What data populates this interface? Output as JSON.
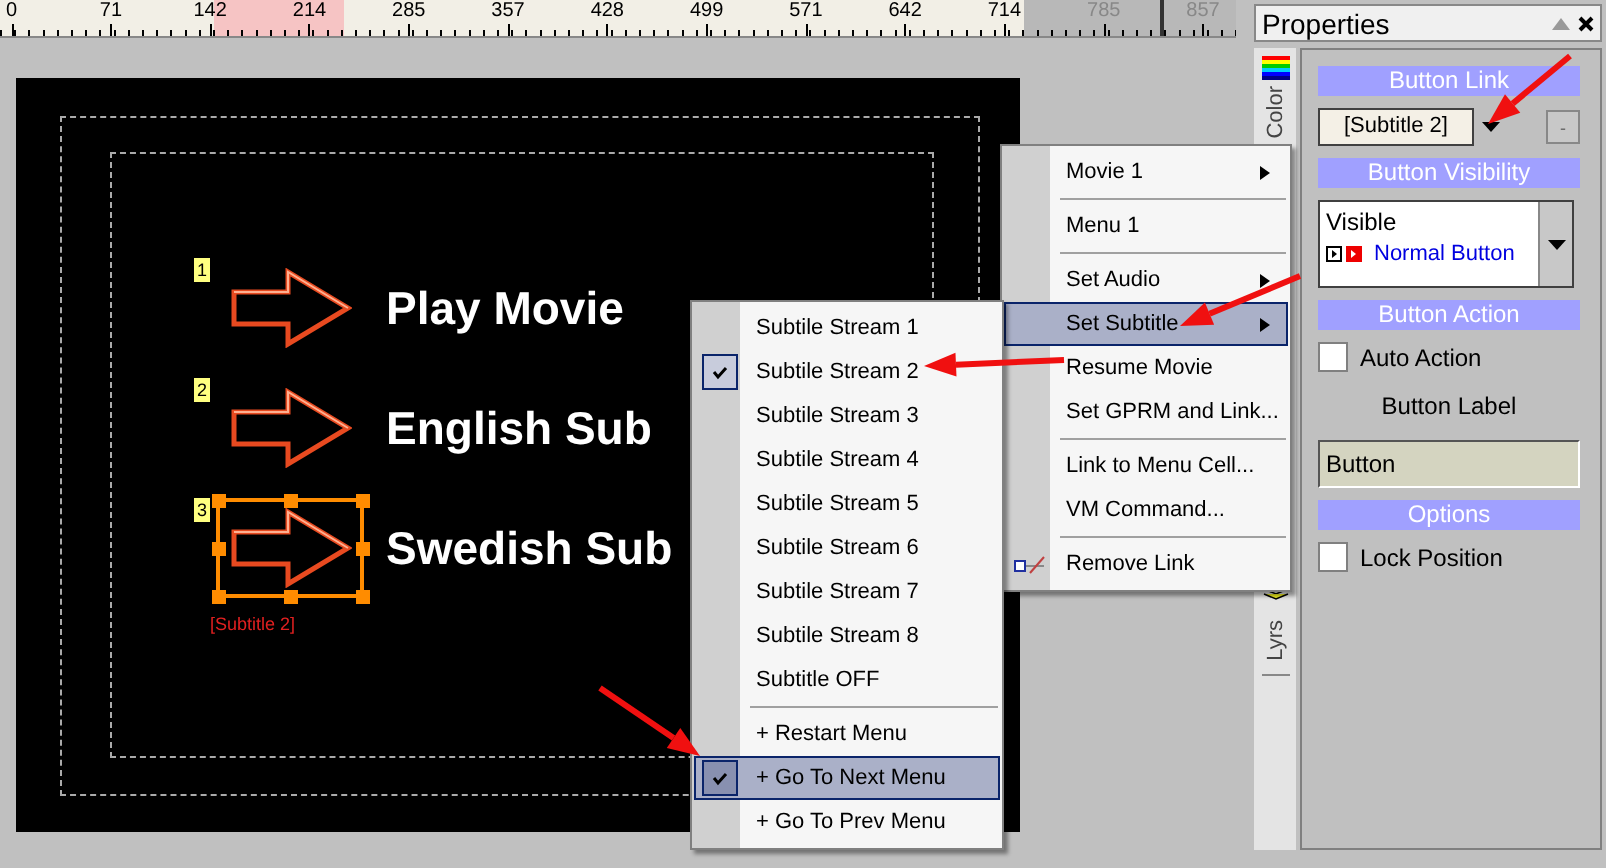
{
  "ruler": {
    "ticks": [
      {
        "label": "0",
        "disabled": false
      },
      {
        "label": "71",
        "disabled": false
      },
      {
        "label": "142",
        "disabled": false
      },
      {
        "label": "214",
        "disabled": false
      },
      {
        "label": "285",
        "disabled": false
      },
      {
        "label": "357",
        "disabled": false
      },
      {
        "label": "428",
        "disabled": false
      },
      {
        "label": "499",
        "disabled": false
      },
      {
        "label": "571",
        "disabled": false
      },
      {
        "label": "642",
        "disabled": false
      },
      {
        "label": "714",
        "disabled": false
      },
      {
        "label": "785",
        "disabled": true
      },
      {
        "label": "857",
        "disabled": true
      }
    ]
  },
  "canvas": {
    "buttons": [
      {
        "number": "1",
        "label": "Play Movie",
        "selected": false
      },
      {
        "number": "2",
        "label": "English Sub",
        "selected": false
      },
      {
        "number": "3",
        "label": "Swedish Sub",
        "selected": true,
        "link": "[Subtitle 2]"
      }
    ]
  },
  "context_menu": {
    "items": [
      {
        "kind": "item",
        "label": "Movie 1",
        "submenu": true,
        "selected": false
      },
      {
        "kind": "separator"
      },
      {
        "kind": "item",
        "label": "Menu 1",
        "submenu": false,
        "selected": false
      },
      {
        "kind": "separator"
      },
      {
        "kind": "item",
        "label": "Set Audio",
        "submenu": true,
        "selected": false
      },
      {
        "kind": "item",
        "label": "Set Subtitle",
        "submenu": true,
        "selected": true
      },
      {
        "kind": "item",
        "label": "Resume Movie",
        "submenu": false,
        "selected": false
      },
      {
        "kind": "item",
        "label": "Set GPRM and Link...",
        "submenu": false,
        "selected": false
      },
      {
        "kind": "separator"
      },
      {
        "kind": "item",
        "label": "Link to Menu Cell...",
        "submenu": false,
        "selected": false
      },
      {
        "kind": "item",
        "label": "VM Command...",
        "submenu": false,
        "selected": false
      },
      {
        "kind": "separator"
      },
      {
        "kind": "item",
        "label": "Remove Link",
        "submenu": false,
        "selected": false,
        "icon": true
      }
    ]
  },
  "submenu": {
    "items": [
      {
        "kind": "item",
        "label": "Subtile Stream 1",
        "checked": false,
        "selected": false
      },
      {
        "kind": "item",
        "label": "Subtile Stream 2",
        "checked": true,
        "selected": false
      },
      {
        "kind": "item",
        "label": "Subtile Stream 3",
        "checked": false,
        "selected": false
      },
      {
        "kind": "item",
        "label": "Subtile Stream 4",
        "checked": false,
        "selected": false
      },
      {
        "kind": "item",
        "label": "Subtile Stream 5",
        "checked": false,
        "selected": false
      },
      {
        "kind": "item",
        "label": "Subtile Stream 6",
        "checked": false,
        "selected": false
      },
      {
        "kind": "item",
        "label": "Subtile Stream 7",
        "checked": false,
        "selected": false
      },
      {
        "kind": "item",
        "label": "Subtile Stream 8",
        "checked": false,
        "selected": false
      },
      {
        "kind": "item",
        "label": "Subtitle OFF",
        "checked": false,
        "selected": false
      },
      {
        "kind": "separator"
      },
      {
        "kind": "item",
        "label": "+ Restart Menu",
        "checked": false,
        "selected": false
      },
      {
        "kind": "item",
        "label": "+ Go To Next Menu",
        "checked": true,
        "selected": true
      },
      {
        "kind": "item",
        "label": "+ Go To Prev Menu",
        "checked": false,
        "selected": false
      }
    ]
  },
  "properties": {
    "title": "Properties",
    "tabs": [
      {
        "kind": "color",
        "label": "Color"
      },
      {
        "kind": "layers",
        "label": "Lyrs"
      }
    ],
    "sections": [
      {
        "kind": "header",
        "label": "Button Link"
      },
      {
        "kind": "combo",
        "value": "[Subtitle 2]",
        "button": "-"
      },
      {
        "kind": "header",
        "label": "Button Visibility"
      },
      {
        "kind": "list",
        "value": "Visible",
        "option": "Normal Button"
      },
      {
        "kind": "header",
        "label": "Button Action"
      },
      {
        "kind": "checkbox",
        "label": "Auto Action",
        "checked": false
      },
      {
        "kind": "label",
        "label": "Button Label"
      },
      {
        "kind": "field",
        "value": "Button"
      },
      {
        "kind": "header",
        "label": "Options"
      },
      {
        "kind": "checkbox",
        "label": "Lock Position",
        "checked": false
      }
    ]
  }
}
